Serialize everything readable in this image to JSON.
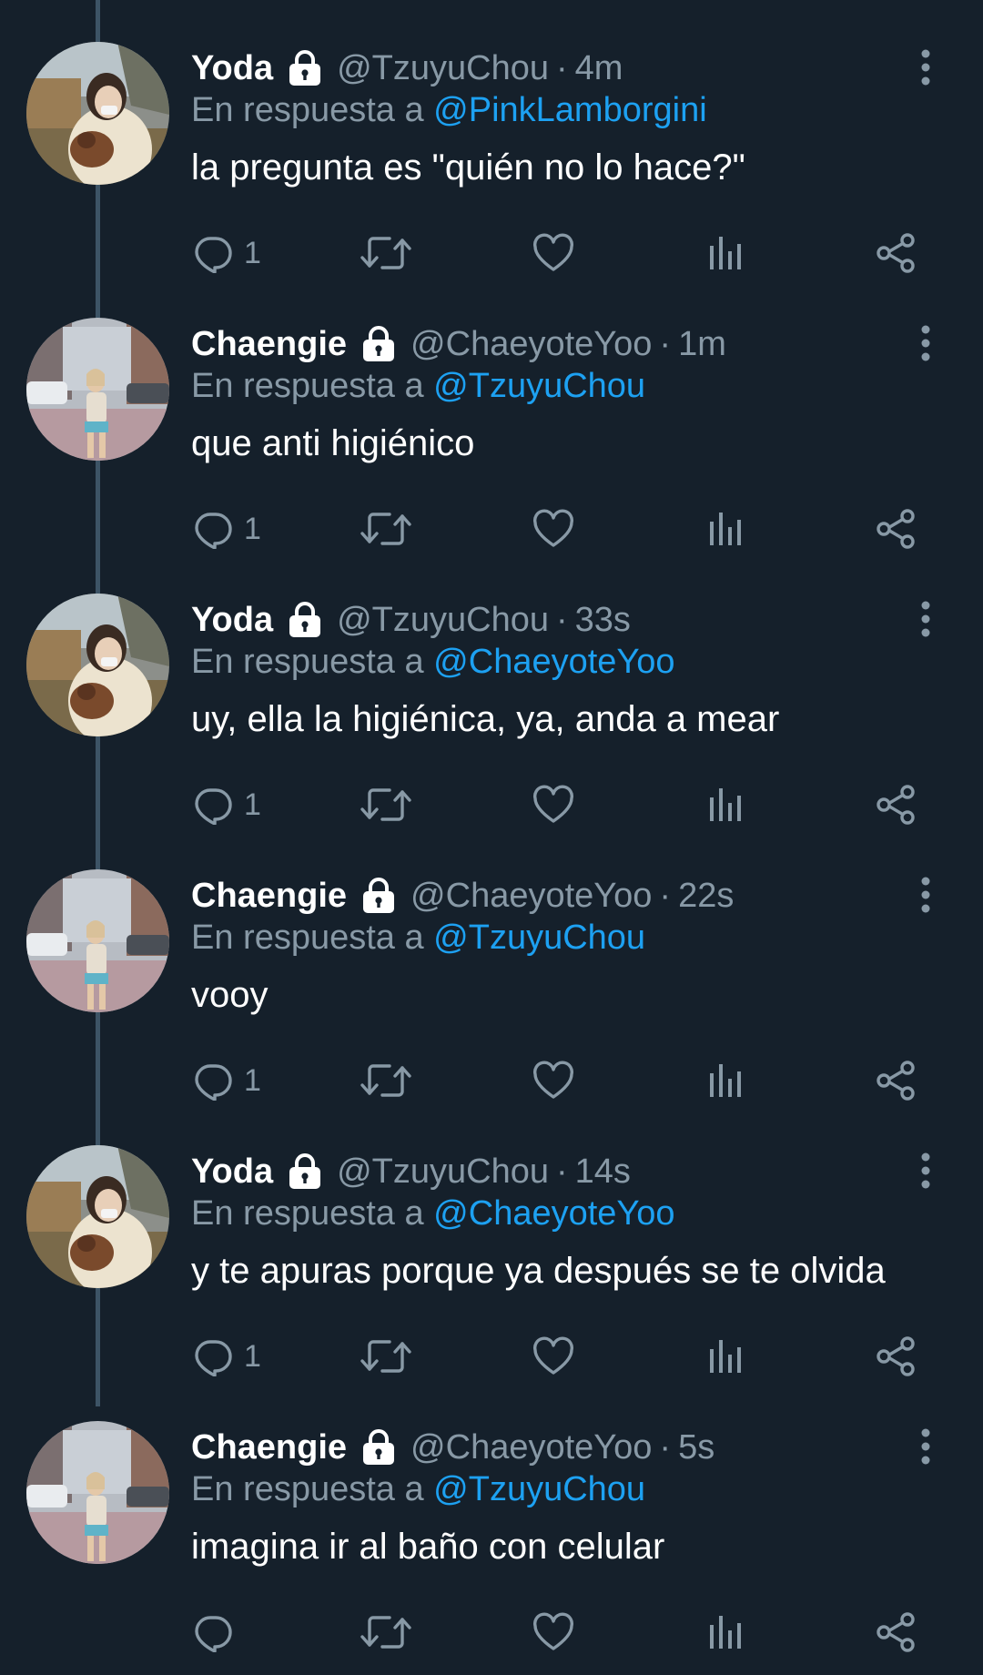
{
  "tweets": [
    {
      "author": "Yoda",
      "handle": "@TzuyuChou",
      "separator": "·",
      "time": "4m",
      "reply_prefix": "En respuesta a",
      "reply_to": "@PinkLamborgini",
      "text": "la pregunta es \"quién no lo hace?\"",
      "reply_count": "1",
      "avatar": "yoda"
    },
    {
      "author": "Chaengie",
      "handle": "@ChaeyoteYoo",
      "separator": "·",
      "time": "1m",
      "reply_prefix": "En respuesta a",
      "reply_to": "@TzuyuChou",
      "text": "que anti higiénico",
      "reply_count": "1",
      "avatar": "chaengie"
    },
    {
      "author": "Yoda",
      "handle": "@TzuyuChou",
      "separator": "·",
      "time": "33s",
      "reply_prefix": "En respuesta a",
      "reply_to": "@ChaeyoteYoo",
      "text": "uy, ella la higiénica, ya, anda a mear",
      "reply_count": "1",
      "avatar": "yoda"
    },
    {
      "author": "Chaengie",
      "handle": "@ChaeyoteYoo",
      "separator": "·",
      "time": "22s",
      "reply_prefix": "En respuesta a",
      "reply_to": "@TzuyuChou",
      "text": "vooy",
      "reply_count": "1",
      "avatar": "chaengie"
    },
    {
      "author": "Yoda",
      "handle": "@TzuyuChou",
      "separator": "·",
      "time": "14s",
      "reply_prefix": "En respuesta a",
      "reply_to": "@ChaeyoteYoo",
      "text": "y te apuras porque ya después se te olvida",
      "reply_count": "1",
      "avatar": "yoda"
    },
    {
      "author": "Chaengie",
      "handle": "@ChaeyoteYoo",
      "separator": "·",
      "time": "5s",
      "reply_prefix": "En respuesta a",
      "reply_to": "@TzuyuChou",
      "text": "imagina ir al baño con celular",
      "reply_count": "",
      "avatar": "chaengie"
    }
  ],
  "icons": {
    "lock": "lock-icon",
    "more": "more-vertical-icon",
    "reply": "reply-icon",
    "retweet": "retweet-icon",
    "like": "heart-icon",
    "analytics": "analytics-icon",
    "share": "share-icon"
  },
  "colors": {
    "background": "#15202b",
    "text": "#ffffff",
    "secondary": "#8899a6",
    "link": "#1da1f2",
    "thread_line": "#3d5466"
  }
}
